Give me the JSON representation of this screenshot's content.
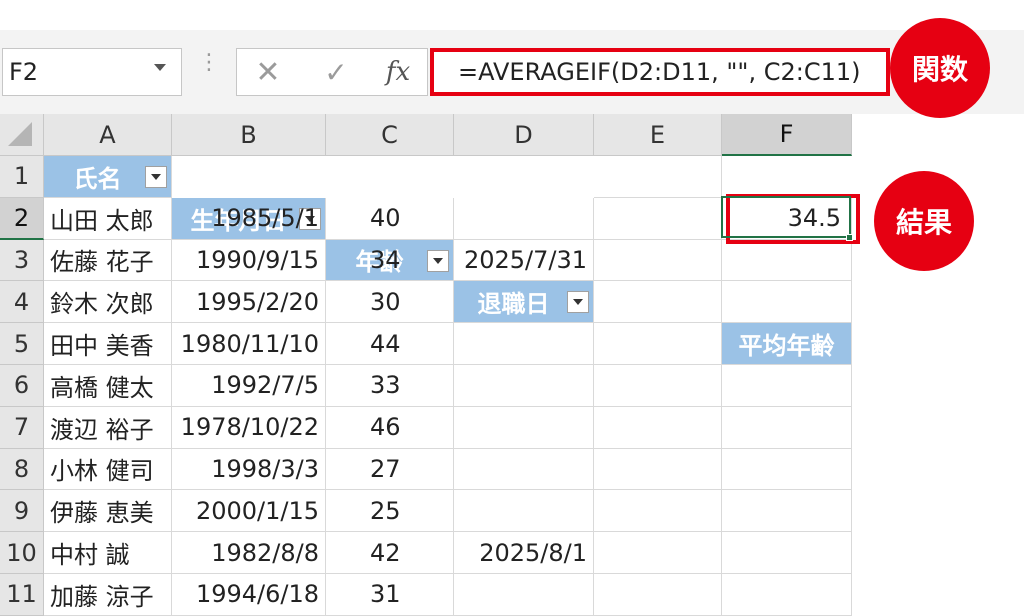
{
  "formula_bar": {
    "name_box": "F2",
    "formula": "=AVERAGEIF(D2:D11, \"\", C2:C11)",
    "dots": "⋮",
    "cancel_icon": "✕",
    "enter_icon": "✓",
    "fx_label": "fx"
  },
  "callouts": {
    "function_label": "関数",
    "result_label": "結果"
  },
  "columns": [
    "A",
    "B",
    "C",
    "D",
    "E",
    "F"
  ],
  "row_numbers": [
    "1",
    "2",
    "3",
    "4",
    "5",
    "6",
    "7",
    "8",
    "9",
    "10",
    "11"
  ],
  "table_headers": {
    "name": "氏名",
    "birthdate": "生年月日",
    "age": "年齢",
    "retirement": "退職日",
    "average": "平均年齢"
  },
  "rows": [
    {
      "name": "山田 太郎",
      "birthdate": "1985/5/1",
      "age": "40",
      "retirement": ""
    },
    {
      "name": "佐藤 花子",
      "birthdate": "1990/9/15",
      "age": "34",
      "retirement": "2025/7/31"
    },
    {
      "name": "鈴木 次郎",
      "birthdate": "1995/2/20",
      "age": "30",
      "retirement": ""
    },
    {
      "name": "田中 美香",
      "birthdate": "1980/11/10",
      "age": "44",
      "retirement": ""
    },
    {
      "name": "高橋 健太",
      "birthdate": "1992/7/5",
      "age": "33",
      "retirement": ""
    },
    {
      "name": "渡辺 裕子",
      "birthdate": "1978/10/22",
      "age": "46",
      "retirement": ""
    },
    {
      "name": "小林 健司",
      "birthdate": "1998/3/3",
      "age": "27",
      "retirement": ""
    },
    {
      "name": "伊藤 恵美",
      "birthdate": "2000/1/15",
      "age": "25",
      "retirement": ""
    },
    {
      "name": "中村 誠",
      "birthdate": "1982/8/8",
      "age": "42",
      "retirement": "2025/8/1"
    },
    {
      "name": "加藤 涼子",
      "birthdate": "1994/6/18",
      "age": "31",
      "retirement": ""
    }
  ],
  "result_value": "34.5",
  "colors": {
    "accent_red": "#e60012",
    "table_header": "#9bc2e6",
    "selection_green": "#217346"
  }
}
